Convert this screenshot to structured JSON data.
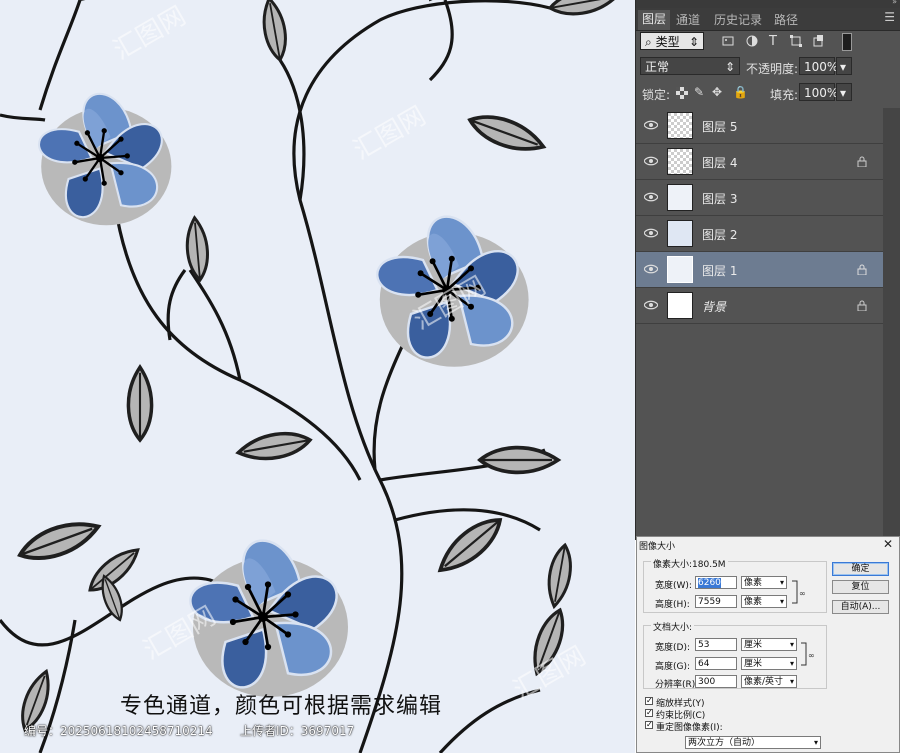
{
  "caption": "专色通道，颜色可根据需求编辑",
  "footer": {
    "id_label": "编号：20250618102458710214",
    "uploader_label": "上传者ID：3697017"
  },
  "watermark": "汇图网",
  "panel": {
    "tabs": [
      "图层",
      "通道",
      "历史记录",
      "路径"
    ],
    "kind_filter": "类型",
    "blend_mode": "正常",
    "opacity_label": "不透明度:",
    "opacity_value": "100%",
    "lock_label": "锁定:",
    "fill_label": "填充:",
    "fill_value": "100%",
    "layers": [
      {
        "name": "图层 5",
        "locked": false,
        "selected": false
      },
      {
        "name": "图层 4",
        "locked": true,
        "selected": false
      },
      {
        "name": "图层 3",
        "locked": false,
        "selected": false
      },
      {
        "name": "图层 2",
        "locked": false,
        "selected": false
      },
      {
        "name": "图层 1",
        "locked": true,
        "selected": true
      },
      {
        "name": "背景",
        "locked": true,
        "selected": false
      }
    ]
  },
  "dialog": {
    "title": "图像大小",
    "pixel_size": "像素大小:180.5M",
    "width_label": "宽度(W):",
    "width_value": "6260",
    "width_unit": "像素",
    "height_label": "高度(H):",
    "height_value": "7559",
    "height_unit": "像素",
    "doc_size": "文档大小:",
    "doc_width_label": "宽度(D):",
    "doc_width_value": "53",
    "doc_width_unit": "厘米",
    "doc_height_label": "高度(G):",
    "doc_height_value": "64",
    "doc_height_unit": "厘米",
    "resolution_label": "分辨率(R):",
    "resolution_value": "300",
    "resolution_unit": "像素/英寸",
    "ok": "确定",
    "reset": "复位",
    "auto": "自动(A)...",
    "scale_styles": "缩放样式(Y)",
    "constrain": "约束比例(C)",
    "resample": "重定图像像素(I):",
    "resample_method": "两次立方（自动）"
  },
  "colors": {
    "canvas_bg": "#e9eef7",
    "petal_dark": "#3a5f9e",
    "petal_light": "#6c93cc",
    "leaf": "#b5b5b5",
    "panel_bg": "#535353",
    "selected_layer": "#6d7c91"
  }
}
